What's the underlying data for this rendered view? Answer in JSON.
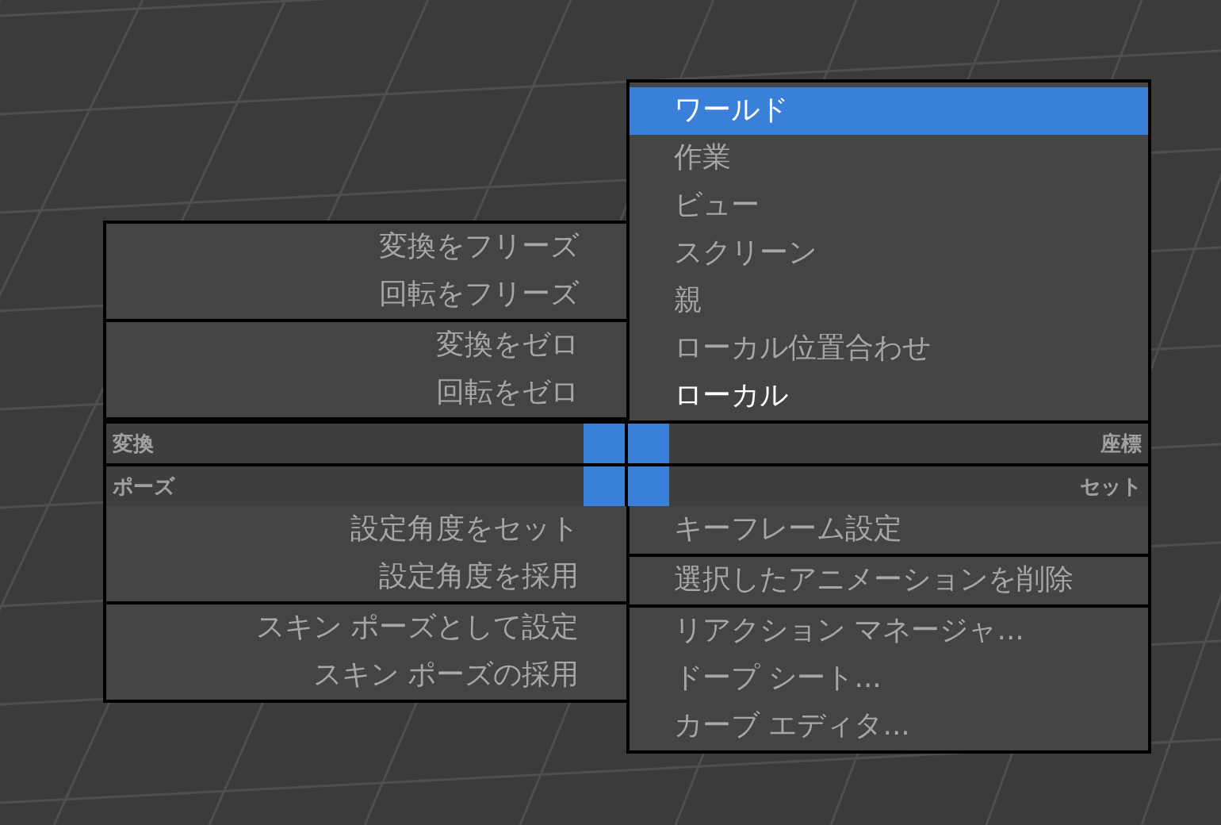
{
  "quad_menu": {
    "top_left": {
      "groups": [
        {
          "items": [
            {
              "label": "変換をフリーズ",
              "selected": false,
              "current": false
            },
            {
              "label": "回転をフリーズ",
              "selected": false,
              "current": false
            }
          ]
        },
        {
          "items": [
            {
              "label": "変換をゼロ",
              "selected": false,
              "current": false
            },
            {
              "label": "回転をゼロ",
              "selected": false,
              "current": false
            }
          ]
        }
      ]
    },
    "top_right": {
      "groups": [
        {
          "items": [
            {
              "label": "ワールド",
              "selected": true,
              "current": false
            },
            {
              "label": "作業",
              "selected": false,
              "current": false
            },
            {
              "label": "ビュー",
              "selected": false,
              "current": false
            },
            {
              "label": "スクリーン",
              "selected": false,
              "current": false
            },
            {
              "label": "親",
              "selected": false,
              "current": false
            },
            {
              "label": "ローカル位置合わせ",
              "selected": false,
              "current": false
            },
            {
              "label": "ローカル",
              "selected": false,
              "current": true
            }
          ]
        }
      ]
    },
    "title_rows": [
      {
        "left": "変換",
        "right": "座標"
      },
      {
        "left": "ポーズ",
        "right": "セット"
      }
    ],
    "bottom_left": {
      "groups": [
        {
          "items": [
            {
              "label": "設定角度をセット",
              "selected": false,
              "current": false
            },
            {
              "label": "設定角度を採用",
              "selected": false,
              "current": false
            }
          ]
        },
        {
          "items": [
            {
              "label": "スキン ポーズとして設定",
              "selected": false,
              "current": false
            },
            {
              "label": "スキン ポーズの採用",
              "selected": false,
              "current": false
            }
          ]
        }
      ]
    },
    "bottom_right": {
      "groups": [
        {
          "items": [
            {
              "label": "キーフレーム設定",
              "selected": false,
              "current": false
            }
          ]
        },
        {
          "items": [
            {
              "label": "選択したアニメーションを削除",
              "selected": false,
              "current": false
            }
          ]
        },
        {
          "items": [
            {
              "label": "リアクション マネージャ...",
              "selected": false,
              "current": false
            },
            {
              "label": "ドープ シート...",
              "selected": false,
              "current": false
            },
            {
              "label": "カーブ エディタ...",
              "selected": false,
              "current": false
            }
          ]
        }
      ]
    }
  }
}
